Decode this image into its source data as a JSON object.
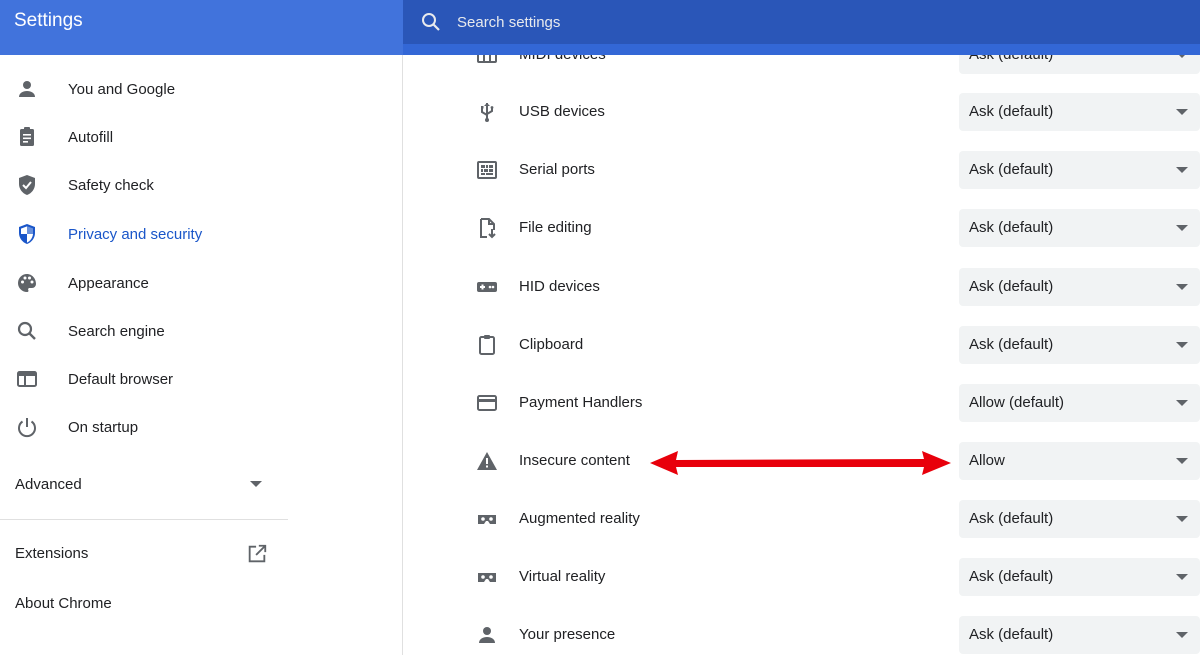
{
  "app": {
    "title": "Settings"
  },
  "search": {
    "placeholder": "Search settings"
  },
  "sidebar": {
    "items": [
      {
        "label": "You and Google",
        "icon": "person-icon"
      },
      {
        "label": "Autofill",
        "icon": "clipboard-list-icon"
      },
      {
        "label": "Safety check",
        "icon": "shield-check-icon"
      },
      {
        "label": "Privacy and security",
        "icon": "shield-icon",
        "active": true
      },
      {
        "label": "Appearance",
        "icon": "palette-icon"
      },
      {
        "label": "Search engine",
        "icon": "search-icon"
      },
      {
        "label": "Default browser",
        "icon": "browser-window-icon"
      },
      {
        "label": "On startup",
        "icon": "power-icon"
      }
    ],
    "advanced_label": "Advanced",
    "extensions_label": "Extensions",
    "about_label": "About Chrome"
  },
  "permissions": {
    "rows": [
      {
        "label": "MIDI devices",
        "value": "Ask (default)",
        "icon": "midi-icon"
      },
      {
        "label": "USB devices",
        "value": "Ask (default)",
        "icon": "usb-icon"
      },
      {
        "label": "Serial ports",
        "value": "Ask (default)",
        "icon": "serial-port-icon"
      },
      {
        "label": "File editing",
        "value": "Ask (default)",
        "icon": "file-edit-icon"
      },
      {
        "label": "HID devices",
        "value": "Ask (default)",
        "icon": "gamepad-icon"
      },
      {
        "label": "Clipboard",
        "value": "Ask (default)",
        "icon": "clipboard-icon"
      },
      {
        "label": "Payment Handlers",
        "value": "Allow (default)",
        "icon": "credit-card-icon"
      },
      {
        "label": "Insecure content",
        "value": "Allow",
        "icon": "warning-icon"
      },
      {
        "label": "Augmented reality",
        "value": "Ask (default)",
        "icon": "vr-headset-icon"
      },
      {
        "label": "Virtual reality",
        "value": "Ask (default)",
        "icon": "vr-headset-icon"
      },
      {
        "label": "Your presence",
        "value": "Ask (default)",
        "icon": "person-icon"
      }
    ]
  },
  "colors": {
    "header": "#3367d6",
    "active_nav": "#1a56c9",
    "annotation_arrow": "#e8000b"
  }
}
